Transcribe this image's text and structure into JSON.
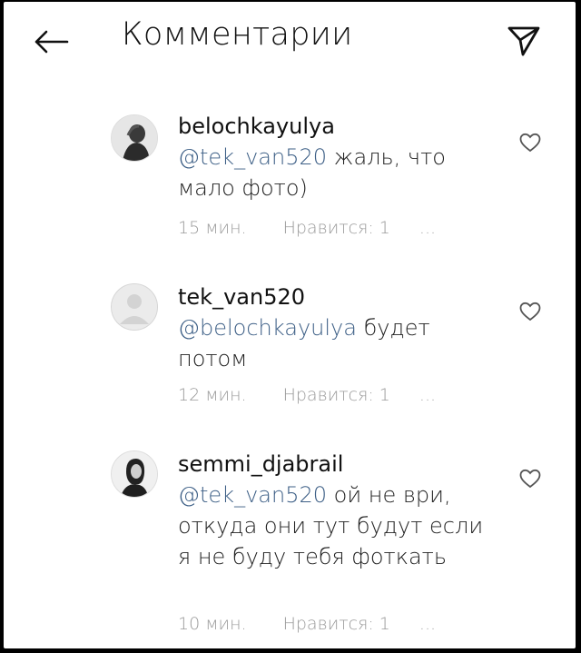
{
  "header": {
    "title": "Комментарии",
    "back_icon": "arrow-left-icon",
    "send_icon": "paper-plane-icon"
  },
  "comments": [
    {
      "username": "belochkayulya",
      "mention": "@tek_van520",
      "text": "жаль, что мало фото)",
      "time": "15 мин.",
      "likes": "Нравится: 1",
      "more": "...",
      "avatar": "user-photo-avatar"
    },
    {
      "username": "tek_van520",
      "mention": "@belochkayulya",
      "text": "будет потом",
      "time": "12 мин.",
      "likes": "Нравится: 1",
      "more": "...",
      "avatar": "default-avatar"
    },
    {
      "username": "semmi_djabrail",
      "mention": "@tek_van520",
      "text": "ой не ври, откуда они тут будут если я не буду тебя фоткать",
      "time": "10 мин.",
      "likes": "Нравится: 1",
      "more": "...",
      "avatar": "user-photo-avatar"
    }
  ],
  "colors": {
    "mention": "#3d5f86",
    "meta": "#9a9a9a",
    "background": "#ffffff"
  }
}
